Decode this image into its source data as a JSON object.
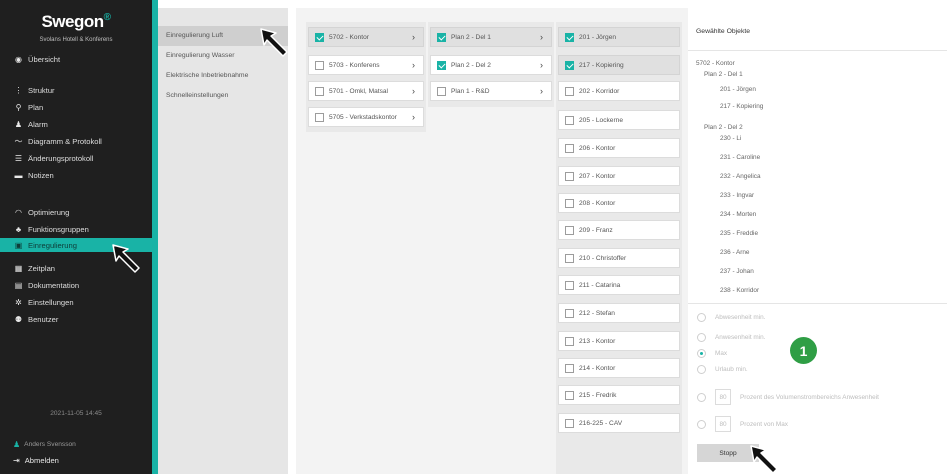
{
  "sidebar": {
    "brand": "Swegon",
    "brand_mark": "®",
    "site": "Svolans Hotell & Konferens",
    "items": [
      {
        "label": "Übersicht",
        "icon": "eye-icon",
        "glyph": "◉"
      },
      {
        "label": "Struktur",
        "icon": "structure-icon",
        "glyph": "⋮"
      },
      {
        "label": "Plan",
        "icon": "map-pin-icon",
        "glyph": "⚲"
      },
      {
        "label": "Alarm",
        "icon": "bell-icon",
        "glyph": "♟"
      },
      {
        "label": "Diagramm & Protokoll",
        "icon": "chart-line-icon",
        "glyph": "〜"
      },
      {
        "label": "Änderungsprotokoll",
        "icon": "list-icon",
        "glyph": "☰"
      },
      {
        "label": "Notizen",
        "icon": "comment-icon",
        "glyph": "▬"
      },
      {
        "label": "Optimierung",
        "icon": "gauge-icon",
        "glyph": "◠"
      },
      {
        "label": "Funktionsgruppen",
        "icon": "hierarchy-icon",
        "glyph": "♣"
      },
      {
        "label": "Einregulierung",
        "icon": "regulation-icon",
        "glyph": "▣"
      },
      {
        "label": "Zeitplan",
        "icon": "calendar-icon",
        "glyph": "▦"
      },
      {
        "label": "Dokumentation",
        "icon": "document-icon",
        "glyph": "▤"
      },
      {
        "label": "Einstellungen",
        "icon": "gear-icon",
        "glyph": "✲"
      },
      {
        "label": "Benutzer",
        "icon": "users-icon",
        "glyph": "⚉"
      }
    ],
    "datetime": "2021-11-05 14:45",
    "user": "Anders Svensson",
    "logout": "Abmelden"
  },
  "submenu": {
    "items": [
      "Einregulierung Luft",
      "Einregulierung Wasser",
      "Elektrische Inbetriebnahme",
      "Schnelleinstellungen"
    ]
  },
  "columns": {
    "zones": [
      "5702 - Kontor",
      "5703 - Konferens",
      "5701 - Omkl, Matsal",
      "5705 - Verkstadskontor"
    ],
    "plans": [
      "Plan 2 - Del 1",
      "Plan 2 - Del 2",
      "Plan 1 - R&D"
    ],
    "rooms": [
      "201 - Jörgen",
      "217 - Kopiering",
      "202 - Korridor",
      "205 - Lockerne",
      "206 - Kontor",
      "207 - Kontor",
      "208 - Kontor",
      "209 - Franz",
      "210 - Christoffer",
      "211 - Catarina",
      "212 - Stefan",
      "213 - Kontor",
      "214 - Kontor",
      "215 - Fredrik",
      "216-225 - CAV"
    ]
  },
  "panel": {
    "title": "Gewählte Objekte",
    "tree": [
      "5702 - Kontor",
      "Plan 2 - Del 1",
      "201 - Jörgen",
      "217 - Kopiering",
      "",
      "Plan 2 - Del 2",
      "230 - Li",
      "231 - Caroline",
      "232 - Angelica",
      "233 - Ingvar",
      "234 - Morten",
      "235 - Freddie",
      "236 - Arne",
      "237 - Johan",
      "238 - Korridor"
    ],
    "options": [
      "Abwesenheit min.",
      "Anwesenheit min.",
      "Max",
      "Urlaub min."
    ],
    "selected_option": "Max",
    "percent_flow_value": "80",
    "percent_flow_label": "Prozent des Volumenstrombereichs Anwesenheit",
    "percent_max_value": "80",
    "percent_max_label": "Prozent von Max",
    "stop_button": "Stopp",
    "badge": "1"
  },
  "colors": {
    "accent": "#19b3a6",
    "sidebar_bg": "#1f1f1f",
    "badge": "#2f9e45"
  }
}
